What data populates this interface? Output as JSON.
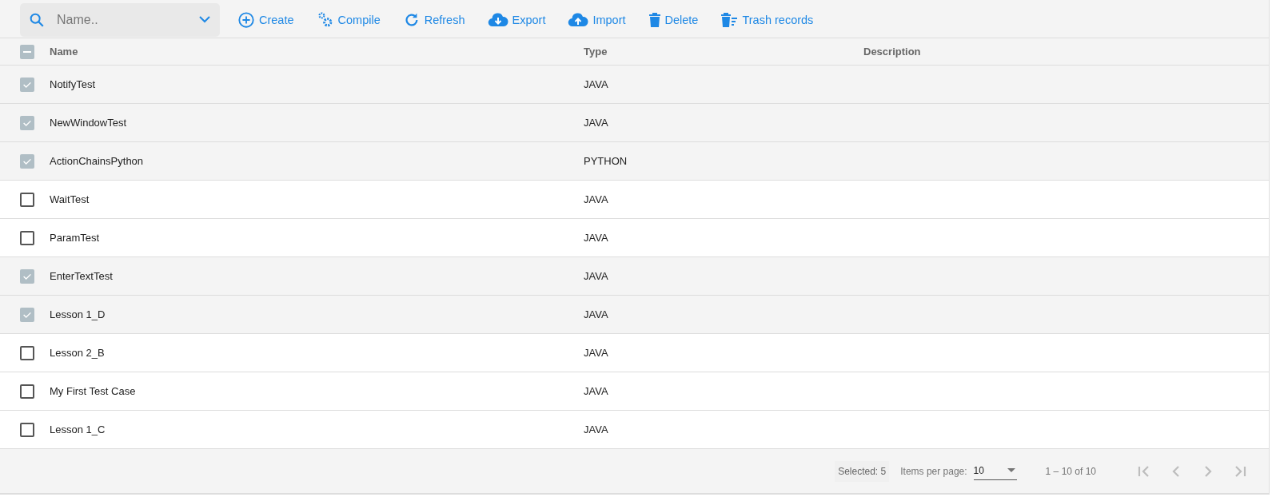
{
  "toolbar": {
    "search": {
      "placeholder": "Name.."
    },
    "actions": [
      {
        "kind": "create",
        "label": "Create"
      },
      {
        "kind": "compile",
        "label": "Compile"
      },
      {
        "kind": "refresh",
        "label": "Refresh"
      },
      {
        "kind": "export",
        "label": "Export"
      },
      {
        "kind": "import",
        "label": "Import"
      },
      {
        "kind": "delete",
        "label": "Delete"
      },
      {
        "kind": "trash",
        "label": "Trash records"
      }
    ]
  },
  "table": {
    "select_all": {
      "indeterminate": true
    },
    "columns": [
      "Name",
      "Type",
      "Description"
    ],
    "rows": [
      {
        "name": "NotifyTest",
        "type": "JAVA",
        "selected": true
      },
      {
        "name": "NewWindowTest",
        "type": "JAVA",
        "selected": true
      },
      {
        "name": "ActionChainsPython",
        "type": "PYTHON",
        "selected": true
      },
      {
        "name": "WaitTest",
        "type": "JAVA",
        "selected": false
      },
      {
        "name": "ParamTest",
        "type": "JAVA",
        "selected": false
      },
      {
        "name": "EnterTextTest",
        "type": "JAVA",
        "selected": true
      },
      {
        "name": "Lesson 1_D",
        "type": "JAVA",
        "selected": true
      },
      {
        "name": "Lesson 2_B",
        "type": "JAVA",
        "selected": false
      },
      {
        "name": "My First Test Case",
        "type": "JAVA",
        "selected": false
      },
      {
        "name": "Lesson 1_C",
        "type": "JAVA",
        "selected": false
      }
    ]
  },
  "paginator": {
    "selected_count": "Selected: 5",
    "items_per_page_label": "Items per page:",
    "items_per_page": "10",
    "range": "1 – 10 of 10"
  }
}
